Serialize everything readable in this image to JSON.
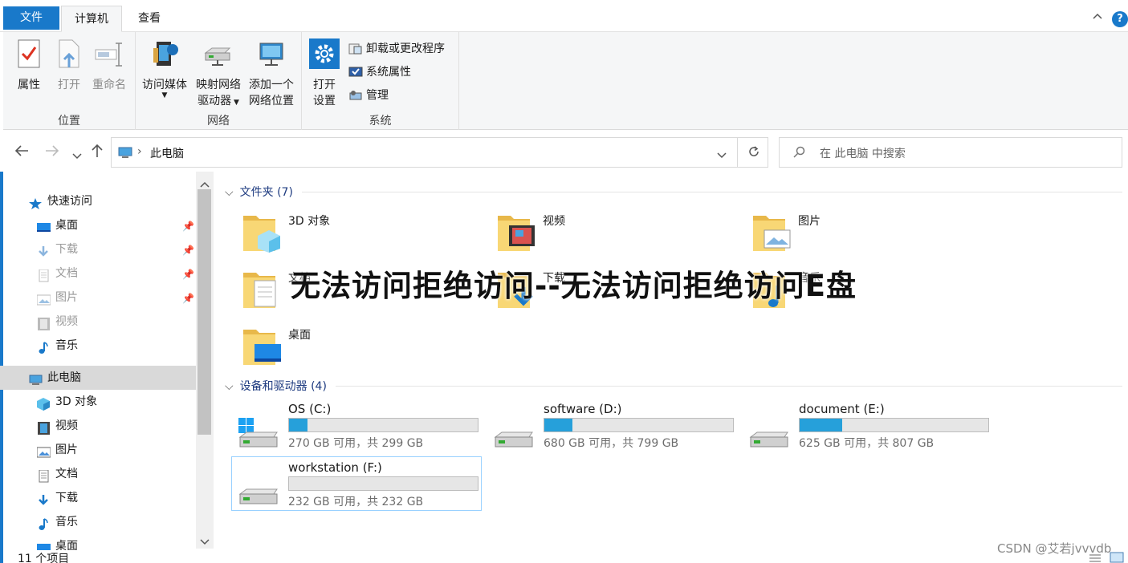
{
  "tabs": {
    "file": "文件",
    "computer": "计算机",
    "view": "查看"
  },
  "ribbon": {
    "location": {
      "properties": "属性",
      "open": "打开",
      "rename": "重命名",
      "group": "位置"
    },
    "network": {
      "access_media": "访问媒体",
      "map_drive_1": "映射网络",
      "map_drive_2": "驱动器",
      "add_location_1": "添加一个",
      "add_location_2": "网络位置",
      "group": "网络"
    },
    "system": {
      "open_settings_1": "打开",
      "open_settings_2": "设置",
      "uninstall": "卸载或更改程序",
      "system_properties": "系统属性",
      "manage": "管理",
      "group": "系统"
    }
  },
  "address": {
    "path": "此电脑",
    "search_placeholder": "在 此电脑 中搜索"
  },
  "sidebar": {
    "quick_access": "快速访问",
    "items": [
      {
        "label": "桌面",
        "icon": "desktop-icon"
      },
      {
        "label": "下载",
        "icon": "download-icon"
      },
      {
        "label": "文档",
        "icon": "document-icon"
      },
      {
        "label": "图片",
        "icon": "picture-icon"
      },
      {
        "label": "视频",
        "icon": "video-icon"
      },
      {
        "label": "音乐",
        "icon": "music-icon"
      }
    ],
    "this_pc": "此电脑",
    "pc_items": [
      {
        "label": "3D 对象"
      },
      {
        "label": "视频"
      },
      {
        "label": "图片"
      },
      {
        "label": "文档"
      },
      {
        "label": "下载"
      },
      {
        "label": "音乐"
      },
      {
        "label": "桌面"
      }
    ]
  },
  "folders": {
    "header": "文件夹 (7)",
    "items": [
      "3D 对象",
      "视频",
      "图片",
      "文档",
      "下载",
      "音乐",
      "桌面"
    ]
  },
  "drives": {
    "header": "设备和驱动器 (4)",
    "items": [
      {
        "name": "OS (C:)",
        "space": "270 GB 可用，共 299 GB",
        "used_fraction": 0.097
      },
      {
        "name": "software (D:)",
        "space": "680 GB 可用，共 799 GB",
        "used_fraction": 0.149
      },
      {
        "name": "document (E:)",
        "space": "625 GB 可用，共 807 GB",
        "used_fraction": 0.226
      },
      {
        "name": "workstation (F:)",
        "space": "232 GB 可用，共 232 GB",
        "used_fraction": 0.0
      }
    ]
  },
  "overlay_text": "无法访问拒绝访问--无法访问拒绝访问E盘",
  "status": {
    "count": "11 个项目"
  },
  "watermark": "CSDN @艾若jvvvdb",
  "colors": {
    "accent": "#1979ca",
    "drive_bar": "#26a0da",
    "folder": "#f8d775"
  }
}
